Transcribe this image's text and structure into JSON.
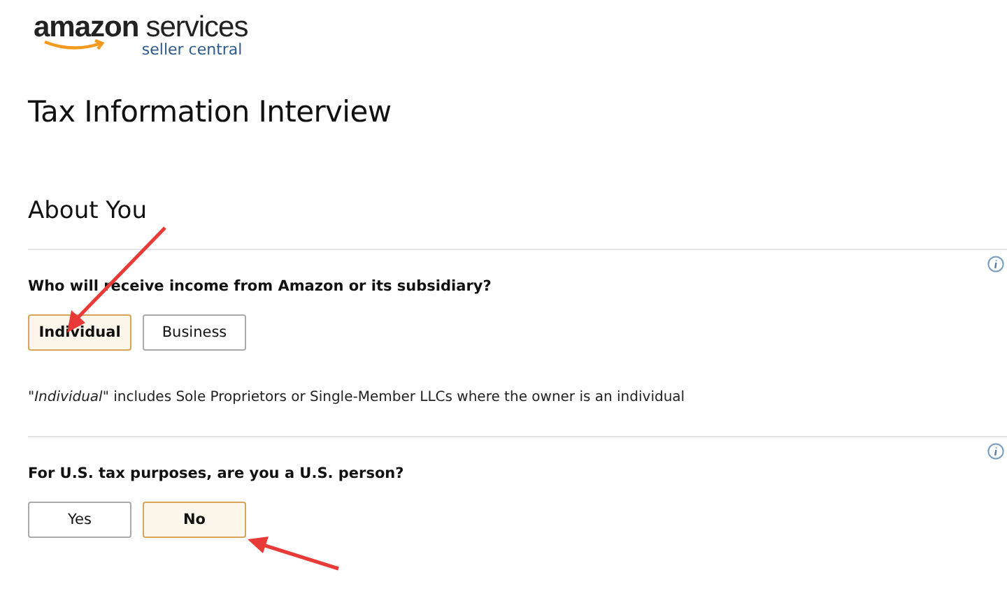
{
  "logo": {
    "brand": "amazon",
    "product": "services",
    "subtitle": "seller central"
  },
  "title": "Tax Information Interview",
  "section": {
    "heading": "About You"
  },
  "questions": [
    {
      "prompt": "Who will receive income from Amazon or its subsidiary?",
      "options": [
        {
          "label": "Individual",
          "selected": true
        },
        {
          "label": "Business",
          "selected": false
        }
      ],
      "note": "\"*Individual*\" includes Sole Proprietors or Single-Member LLCs where the owner is an individual"
    },
    {
      "prompt": "For U.S. tax purposes, are you a U.S. person?",
      "options": [
        {
          "label": "Yes",
          "selected": false
        },
        {
          "label": "No",
          "selected": true
        }
      ]
    }
  ]
}
